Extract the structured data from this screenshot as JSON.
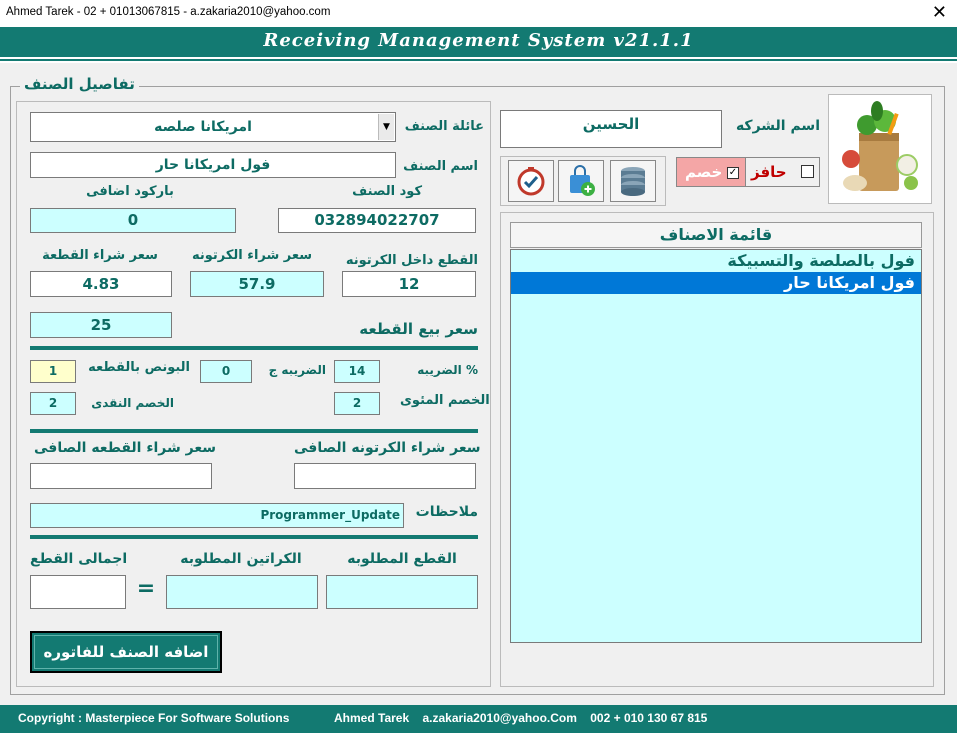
{
  "window": {
    "title": "Ahmed Tarek - 02 + 01013067815 - a.zakaria2010@yahoo.com",
    "close_glyph": "✕",
    "banner": "Receiving Management System v21.1.1"
  },
  "details": {
    "group_title": "تفاصيل الصنف",
    "family_label": "عائلة الصنف",
    "family_value": "امريكانا صلصه",
    "name_label": "اسم الصنف",
    "name_value": "فول امريكانا حار",
    "code_label": "كود الصنف",
    "code_value": "032894022707",
    "extra_barcode_label": "باركود اضافى",
    "extra_barcode_value": "0",
    "pieces_per_carton_label": "القطع داخل الكرتونه",
    "pieces_per_carton_value": "12",
    "carton_price_label": "سعر شراء الكرتونه",
    "carton_price_value": "57.9",
    "piece_price_label": "سعر شراء القطعة",
    "piece_price_value": "4.83",
    "sale_price_label": "سعر بيع القطعه",
    "sale_price_value": "25",
    "tax_pct_label": "الضريبه %",
    "tax_pct_value": "14",
    "tax_amount_label": "الضريبه ج",
    "tax_amount_value": "0",
    "bonus_label": "البونص بالقطعه",
    "bonus_value": "1",
    "discount_pct_label": "الخصم المئوى",
    "discount_pct_value": "2",
    "cash_discount_label": "الخصم النقدى",
    "cash_discount_value": "2",
    "net_carton_label": "سعر شراء الكرتونه الصافى",
    "net_carton_value": "",
    "net_piece_label": "سعر شراء القطعه الصافى",
    "net_piece_value": "",
    "notes_label": "ملاحظات",
    "notes_value": "Programmer_Update",
    "req_pieces_label": "القطع المطلوبه",
    "req_pieces_value": "",
    "req_cartons_label": "الكراتين المطلوبه",
    "req_cartons_value": "",
    "equals": "=",
    "total_pieces_label": "اجمالى القطع",
    "total_pieces_value": "",
    "add_button": "اضافه الصنف للفاتوره"
  },
  "supplier": {
    "company_label": "اسم الشركه",
    "company_value": "الحسين",
    "cash_label": "حافز",
    "discount_label": "خصم",
    "cash_checked": false,
    "discount_checked": true
  },
  "items": {
    "header": "قائمة الاصناف",
    "rows": [
      {
        "label": "فول بالصلصة والتسبيكة",
        "selected": false
      },
      {
        "label": "فول امريكانا حار",
        "selected": true
      }
    ]
  },
  "icons": {
    "product": "grocery-bag-icon",
    "database": "database-icon",
    "add_cart": "add-shopping-bag-icon",
    "clock": "clock-check-icon"
  },
  "footer": {
    "copyright": "Copyright : Masterpiece For Software Solutions",
    "contact": "Ahmed Tarek    a.zakaria2010@yahoo.Com    002 + 010 130 67 815"
  },
  "colors": {
    "teal": "#137a72",
    "label_teal": "#0d6b63",
    "cyan_field": "#ccffff",
    "yellow_field": "#ffffcc",
    "selection": "#0078d7"
  }
}
